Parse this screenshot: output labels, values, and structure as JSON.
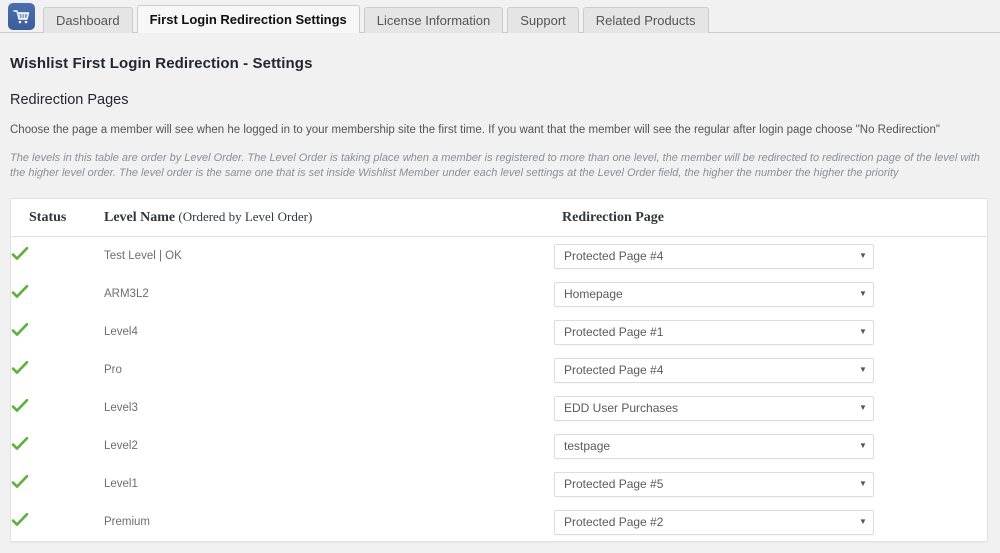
{
  "tabs": {
    "icon": "shopping-cart-icon",
    "items": [
      {
        "label": "Dashboard",
        "active": false
      },
      {
        "label": "First Login Redirection Settings",
        "active": true
      },
      {
        "label": "License Information",
        "active": false
      },
      {
        "label": "Support",
        "active": false
      },
      {
        "label": "Related Products",
        "active": false
      }
    ]
  },
  "page": {
    "title": "Wishlist First Login Redirection - Settings",
    "section_title": "Redirection Pages",
    "description": "Choose the page a member will see when he logged in to your membership site the first time. If you want that the member will see the regular after login page choose \"No Redirection\"",
    "note": "The levels in this table are order by Level Order. The Level Order is taking place when a member is registered to more than one level, the member will be redirected to redirection page of the level with the higher level order. The level order is the same one that is set inside Wishlist Member under each level settings at the Level Order field, the higher the number the higher the priority"
  },
  "table": {
    "headers": {
      "status": "Status",
      "level_name": "Level Name",
      "level_name_sub": " (Ordered by Level Order)",
      "redirection_page": "Redirection Page"
    },
    "rows": [
      {
        "status": "enabled-check-icon",
        "level": "Test Level | OK",
        "redirect": "Protected Page #4"
      },
      {
        "status": "enabled-check-icon",
        "level": "ARM3L2",
        "redirect": "Homepage"
      },
      {
        "status": "enabled-check-icon",
        "level": "Level4",
        "redirect": "Protected Page #1"
      },
      {
        "status": "enabled-check-icon",
        "level": "Pro",
        "redirect": "Protected Page #4"
      },
      {
        "status": "enabled-check-icon",
        "level": "Level3",
        "redirect": "EDD User Purchases"
      },
      {
        "status": "enabled-check-icon",
        "level": "Level2",
        "redirect": "testpage"
      },
      {
        "status": "enabled-check-icon",
        "level": "Level1",
        "redirect": "Protected Page #5"
      },
      {
        "status": "enabled-check-icon",
        "level": "Premium",
        "redirect": "Protected Page #2"
      }
    ]
  },
  "colors": {
    "accent_blue": "#3b5d9c",
    "check_green": "#5bb13a",
    "page_bg": "#f1f1f1",
    "panel_bg": "#ffffff",
    "note_text": "#8b8f94"
  }
}
